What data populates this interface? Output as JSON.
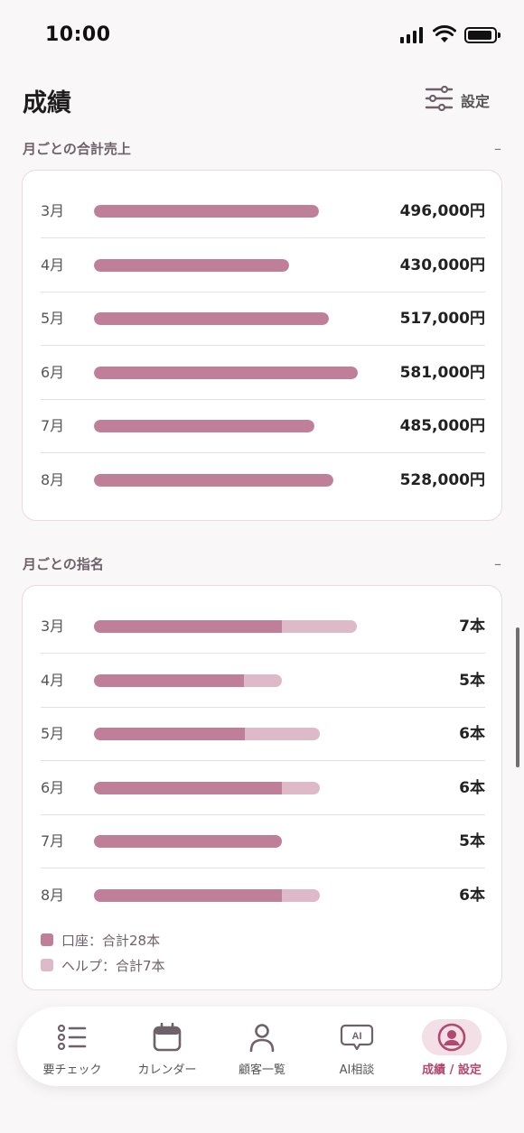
{
  "status_bar": {
    "time": "10:00"
  },
  "header": {
    "title": "成績",
    "settings_label": "設定"
  },
  "sales": {
    "title": "月ごとの合計売上",
    "collapse_symbol": "–",
    "rows": [
      {
        "month": "3月",
        "value": 496000,
        "label": "496,000円"
      },
      {
        "month": "4月",
        "value": 430000,
        "label": "430,000円"
      },
      {
        "month": "5月",
        "value": 517000,
        "label": "517,000円"
      },
      {
        "month": "6月",
        "value": 581000,
        "label": "581,000円"
      },
      {
        "month": "7月",
        "value": 485000,
        "label": "485,000円"
      },
      {
        "month": "8月",
        "value": 528000,
        "label": "528,000円"
      }
    ]
  },
  "nominations": {
    "title": "月ごとの指名",
    "collapse_symbol": "–",
    "rows": [
      {
        "month": "3月",
        "account": 5,
        "help": 2,
        "label": "7本"
      },
      {
        "month": "4月",
        "account": 4,
        "help": 1,
        "label": "5本"
      },
      {
        "month": "5月",
        "account": 4,
        "help": 2,
        "label": "6本"
      },
      {
        "month": "6月",
        "account": 5,
        "help": 1,
        "label": "6本"
      },
      {
        "month": "7月",
        "account": 5,
        "help": 0,
        "label": "5本"
      },
      {
        "month": "8月",
        "account": 5,
        "help": 1,
        "label": "6本"
      }
    ],
    "legend": [
      {
        "name": "口座：合計28本",
        "color": "#c07f99"
      },
      {
        "name": "ヘルプ：合計7本",
        "color": "#debac8"
      }
    ]
  },
  "tabs": [
    {
      "label": "要チェック",
      "icon": "checklist-icon"
    },
    {
      "label": "カレンダー",
      "icon": "calendar-icon"
    },
    {
      "label": "顧客一覧",
      "icon": "person-icon"
    },
    {
      "label": "AI相談",
      "icon": "ai-chat-icon"
    },
    {
      "label": "成績 / 設定",
      "icon": "profile-icon",
      "active": true
    }
  ],
  "colors": {
    "accent": "#b0486f",
    "bar_primary": "#c07f99",
    "bar_secondary": "#debac8",
    "active_tab_bg": "#f3dfe6"
  }
}
